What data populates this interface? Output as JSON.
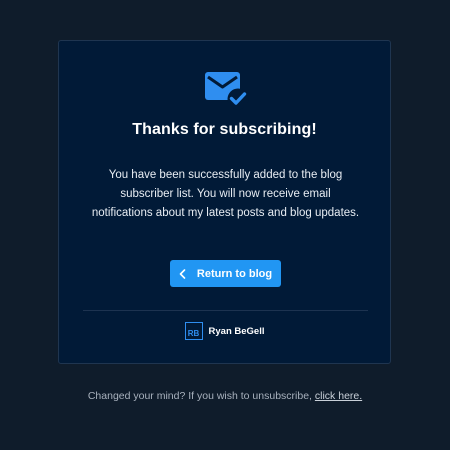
{
  "card": {
    "title": "Thanks for subscribing!",
    "message": "You have been successfully added to the blog subscriber list. You will now receive email notifications about my latest posts and blog updates.",
    "return_button": {
      "label": "Return to blog",
      "icon": "chevron-left-icon"
    },
    "brand": {
      "logo_text": "RB",
      "name": "Ryan BeGell"
    },
    "header_icon": "mail-check-icon"
  },
  "footer": {
    "text": "Changed your mind? If you wish to unsubscribe,",
    "link_label": "click here."
  },
  "colors": {
    "background": "#0f1c2b",
    "card": "#011a37",
    "accent": "#2196f3"
  }
}
